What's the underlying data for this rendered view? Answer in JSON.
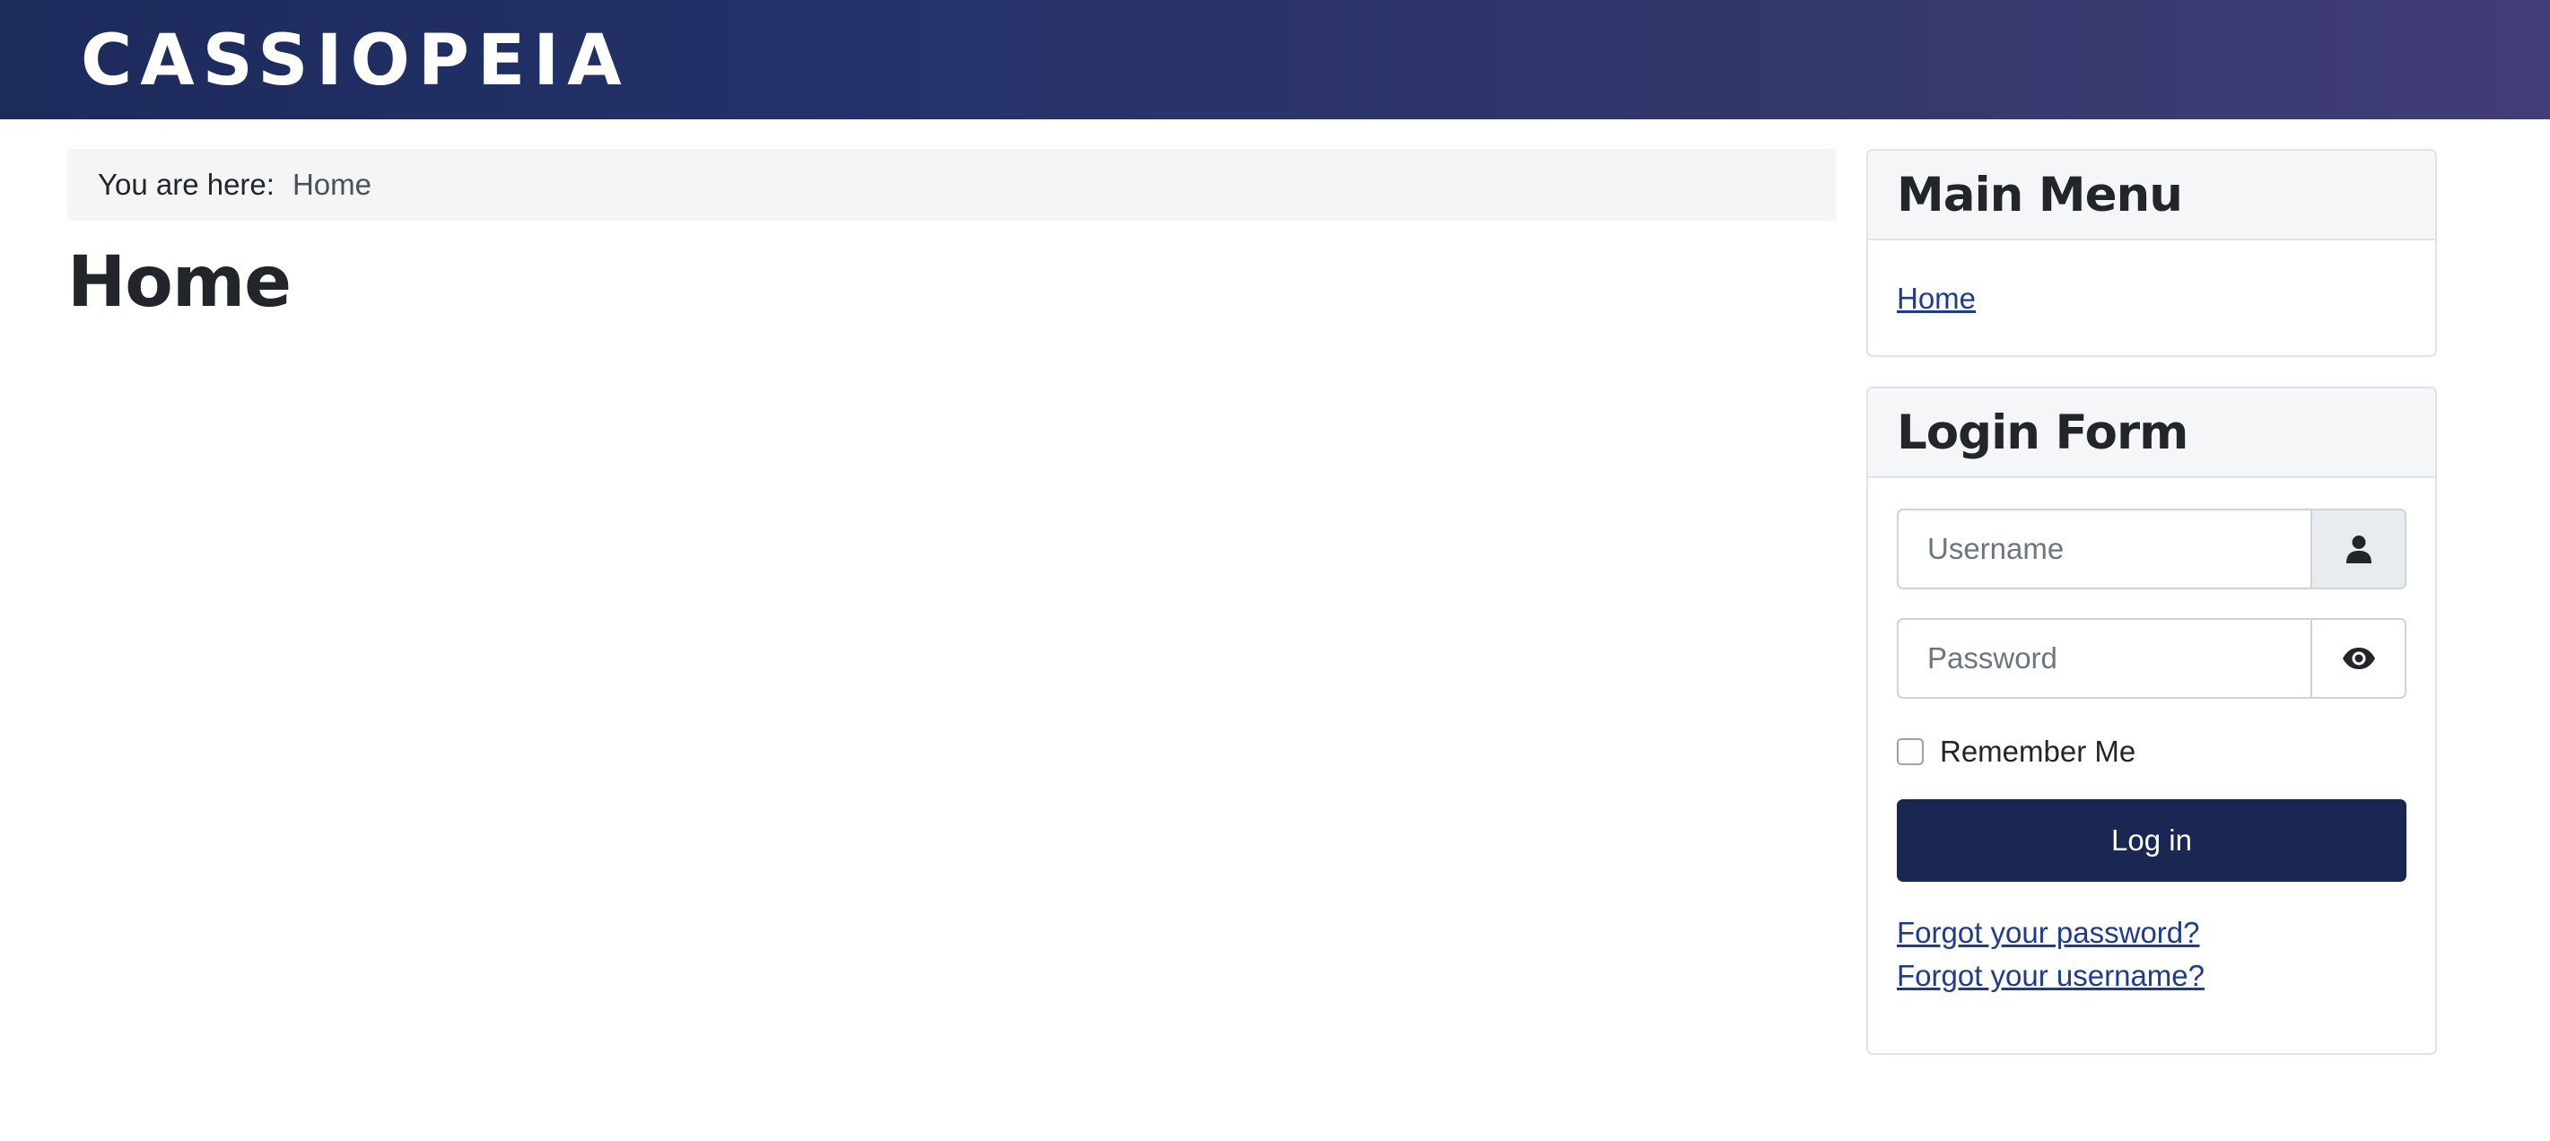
{
  "header": {
    "brand": "CASSIOPEIA",
    "background_start": "#1c2a5c",
    "background_end": "#423d78"
  },
  "breadcrumb": {
    "prefix": "You are here:",
    "current": "Home"
  },
  "page": {
    "title": "Home"
  },
  "main_menu": {
    "title": "Main Menu",
    "items": [
      {
        "label": "Home"
      }
    ]
  },
  "login_form": {
    "title": "Login Form",
    "username": {
      "placeholder": "Username",
      "value": "",
      "icon": "user-icon"
    },
    "password": {
      "placeholder": "Password",
      "value": "",
      "icon": "eye-icon"
    },
    "remember_me": {
      "label": "Remember Me",
      "checked": false
    },
    "submit_label": "Log in",
    "forgot_password": "Forgot your password?",
    "forgot_username": "Forgot your username?"
  },
  "colors": {
    "link": "#1f3b8f",
    "button": "#1a2753",
    "card_border": "#dfe3e7"
  }
}
